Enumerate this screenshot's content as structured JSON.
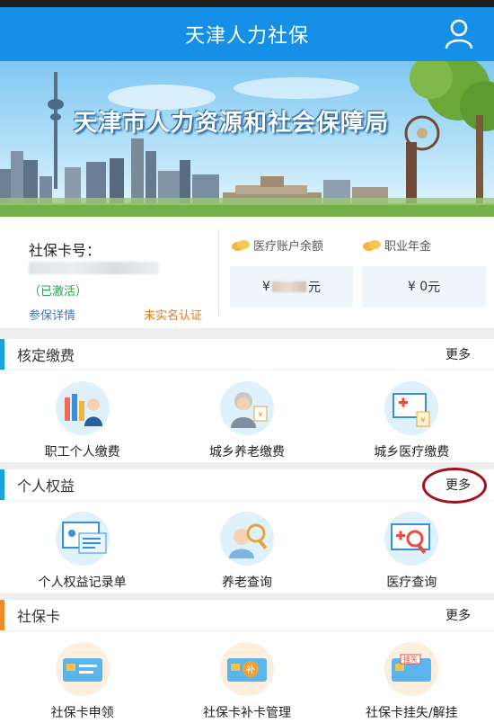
{
  "app": {
    "title": "天津人力社保"
  },
  "banner": {
    "title": "天津市人力资源和社会保障局"
  },
  "card": {
    "cardno_label": "社保卡号：",
    "status": "（已激活）",
    "detail_link": "参保详情",
    "auth_link": "未实名认证",
    "medical": {
      "label": "医疗账户余额",
      "prefix": "¥",
      "unit": "元"
    },
    "annuity": {
      "label": "职业年金",
      "value": "¥ 0",
      "unit": "元"
    }
  },
  "sections": [
    {
      "title": "核定缴费",
      "more": "更多",
      "color": "#19a3e2",
      "items": [
        {
          "label": "职工个人缴费",
          "icon": "worker-payment-icon"
        },
        {
          "label": "城乡养老缴费",
          "icon": "elderly-payment-icon"
        },
        {
          "label": "城乡医疗缴费",
          "icon": "medical-payment-icon"
        }
      ]
    },
    {
      "title": "个人权益",
      "more": "更多",
      "color": "#19a3e2",
      "items": [
        {
          "label": "个人权益记录单",
          "icon": "record-icon"
        },
        {
          "label": "养老查询",
          "icon": "pension-query-icon"
        },
        {
          "label": "医疗查询",
          "icon": "medical-query-icon"
        }
      ]
    },
    {
      "title": "社保卡",
      "more": "更多",
      "color": "#f08a2a",
      "items": [
        {
          "label": "社保卡申领",
          "icon": "card-apply-icon"
        },
        {
          "label": "社保卡补卡管理",
          "icon": "card-reissue-icon"
        },
        {
          "label": "社保卡挂失/解挂",
          "icon": "card-loss-icon"
        }
      ]
    }
  ],
  "banner_badge": {
    "reissue": "补",
    "loss": "挂失"
  }
}
